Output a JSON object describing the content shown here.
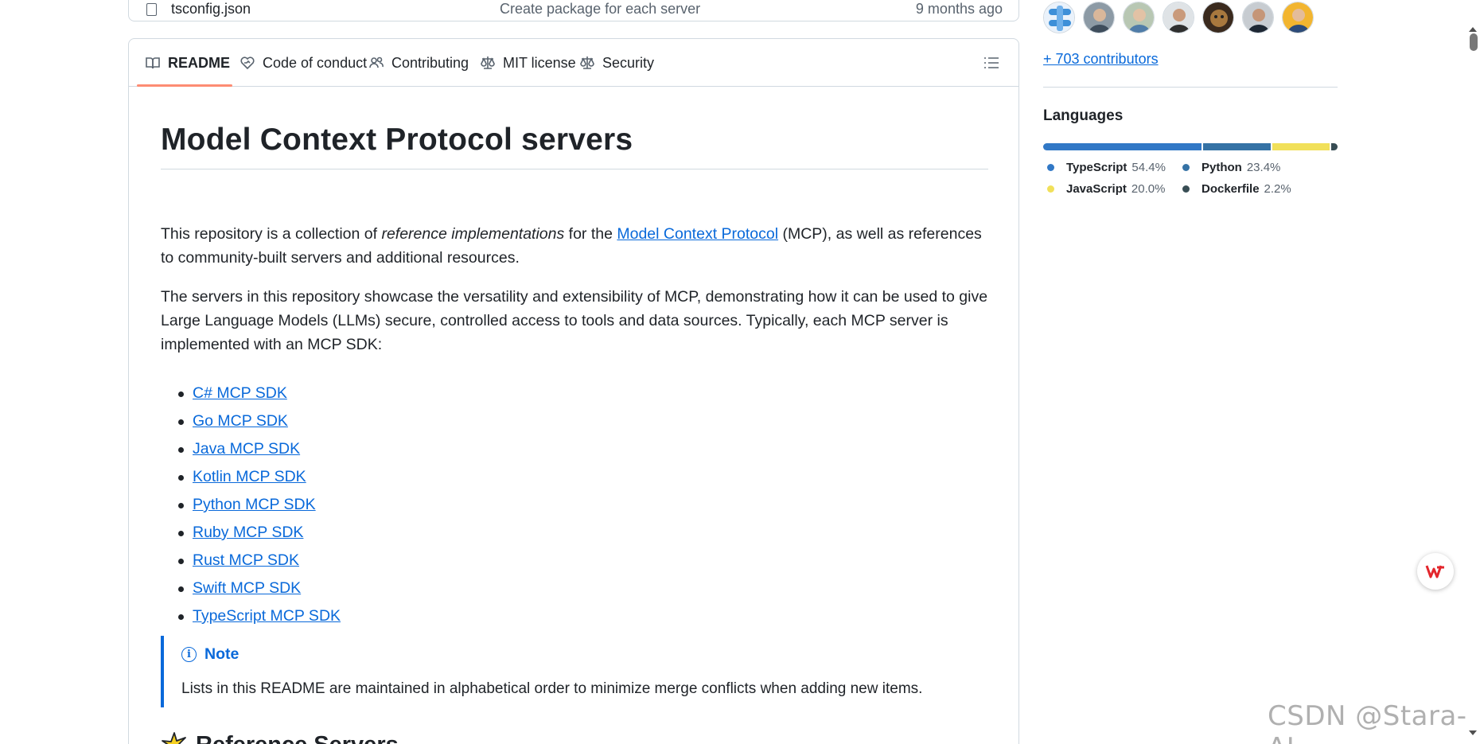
{
  "file_row": {
    "name": "tsconfig.json",
    "commit_message": "Create package for each server",
    "age": "9 months ago"
  },
  "tabs": [
    {
      "label": "README",
      "icon": "book-icon",
      "active": true
    },
    {
      "label": "Code of conduct",
      "icon": "code-of-conduct-icon"
    },
    {
      "label": "Contributing",
      "icon": "people-icon"
    },
    {
      "label": "MIT license",
      "icon": "law-icon"
    },
    {
      "label": "Security",
      "icon": "law-icon"
    }
  ],
  "readme": {
    "title": "Model Context Protocol servers",
    "p1": {
      "before": "This repository is a collection of ",
      "em": "reference implementations",
      "mid": " for the ",
      "link": "Model Context Protocol",
      "after": " (MCP), as well as references to community-built servers and additional resources."
    },
    "p2": "The servers in this repository showcase the versatility and extensibility of MCP, demonstrating how it can be used to give Large Language Models (LLMs) secure, controlled access to tools and data sources. Typically, each MCP server is implemented with an MCP SDK:",
    "sdks": [
      "C# MCP SDK",
      "Go MCP SDK",
      "Java MCP SDK",
      "Kotlin MCP SDK",
      "Python MCP SDK",
      "Ruby MCP SDK",
      "Rust MCP SDK",
      "Swift MCP SDK",
      "TypeScript MCP SDK"
    ],
    "note": {
      "title": "Note",
      "text": "Lists in this README are maintained in alphabetical order to minimize merge conflicts when adding new items."
    },
    "h2": "Reference Servers"
  },
  "sidebar": {
    "contributors_link": "+ 703 contributors",
    "languages_title": "Languages",
    "languages": [
      {
        "name": "TypeScript",
        "pct": "54.4%",
        "value": 54.4,
        "color": "#3178c6"
      },
      {
        "name": "Python",
        "pct": "23.4%",
        "value": 23.4,
        "color": "#3572A5"
      },
      {
        "name": "JavaScript",
        "pct": "20.0%",
        "value": 20.0,
        "color": "#f1e05a"
      },
      {
        "name": "Dockerfile",
        "pct": "2.2%",
        "value": 2.2,
        "color": "#384d54"
      }
    ]
  },
  "watermark": "CSDN @Stara-AI"
}
